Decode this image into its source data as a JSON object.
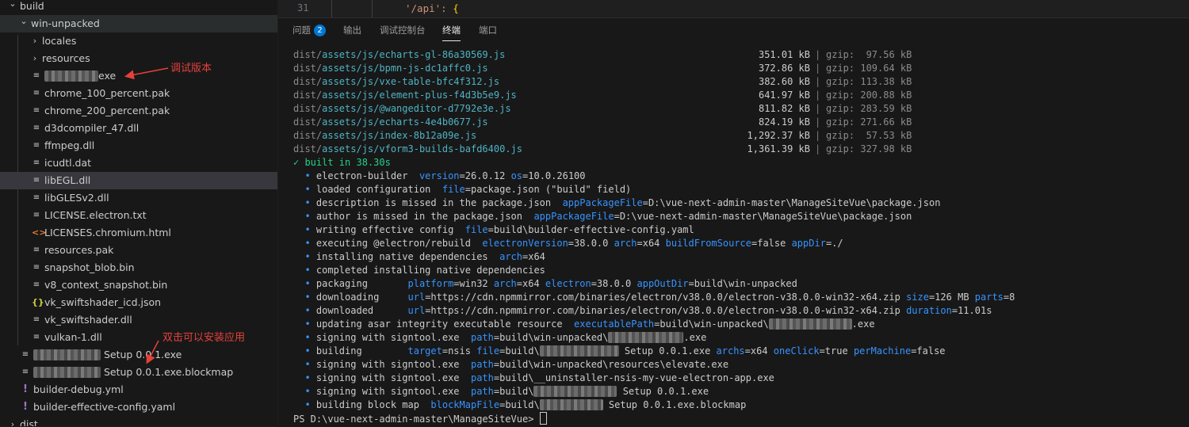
{
  "explorer": {
    "items": [
      {
        "type": "folder",
        "open": true,
        "indent": 0,
        "label": "build",
        "cls": ""
      },
      {
        "type": "folder",
        "open": true,
        "indent": 1,
        "label": "win-unpacked",
        "cls": "sel-top"
      },
      {
        "type": "folder",
        "open": false,
        "indent": 2,
        "label": "locales",
        "cls": ""
      },
      {
        "type": "folder",
        "open": false,
        "indent": 2,
        "label": "resources",
        "cls": ""
      },
      {
        "type": "file",
        "icon": "file",
        "indent": 2,
        "blur": 68,
        "label": "exe",
        "cls": ""
      },
      {
        "type": "file",
        "icon": "file",
        "indent": 2,
        "label": "chrome_100_percent.pak",
        "cls": ""
      },
      {
        "type": "file",
        "icon": "file",
        "indent": 2,
        "label": "chrome_200_percent.pak",
        "cls": ""
      },
      {
        "type": "file",
        "icon": "file",
        "indent": 2,
        "label": "d3dcompiler_47.dll",
        "cls": ""
      },
      {
        "type": "file",
        "icon": "file",
        "indent": 2,
        "label": "ffmpeg.dll",
        "cls": ""
      },
      {
        "type": "file",
        "icon": "file",
        "indent": 2,
        "label": "icudtl.dat",
        "cls": ""
      },
      {
        "type": "file",
        "icon": "file",
        "indent": 2,
        "label": "libEGL.dll",
        "cls": "sel"
      },
      {
        "type": "file",
        "icon": "file",
        "indent": 2,
        "label": "libGLESv2.dll",
        "cls": ""
      },
      {
        "type": "file",
        "icon": "file",
        "indent": 2,
        "label": "LICENSE.electron.txt",
        "cls": ""
      },
      {
        "type": "file",
        "icon": "html",
        "indent": 2,
        "label": "LICENSES.chromium.html",
        "cls": ""
      },
      {
        "type": "file",
        "icon": "file",
        "indent": 2,
        "label": "resources.pak",
        "cls": ""
      },
      {
        "type": "file",
        "icon": "file",
        "indent": 2,
        "label": "snapshot_blob.bin",
        "cls": ""
      },
      {
        "type": "file",
        "icon": "file",
        "indent": 2,
        "label": "v8_context_snapshot.bin",
        "cls": ""
      },
      {
        "type": "file",
        "icon": "json",
        "indent": 2,
        "label": "vk_swiftshader_icd.json",
        "cls": ""
      },
      {
        "type": "file",
        "icon": "file",
        "indent": 2,
        "label": "vk_swiftshader.dll",
        "cls": ""
      },
      {
        "type": "file",
        "icon": "file",
        "indent": 2,
        "label": "vulkan-1.dll",
        "cls": ""
      },
      {
        "type": "file",
        "icon": "file",
        "indent": 1,
        "blur": 85,
        "label": "Setup 0.0.1.exe",
        "cls": ""
      },
      {
        "type": "file",
        "icon": "file",
        "indent": 1,
        "blur": 85,
        "label": "Setup 0.0.1.exe.blockmap",
        "cls": ""
      },
      {
        "type": "file",
        "icon": "yml",
        "indent": 1,
        "label": "builder-debug.yml",
        "cls": ""
      },
      {
        "type": "file",
        "icon": "yml",
        "indent": 1,
        "label": "builder-effective-config.yaml",
        "cls": ""
      },
      {
        "type": "folder",
        "open": false,
        "indent": 0,
        "label": "dist",
        "cls": ""
      }
    ]
  },
  "annotations": {
    "debug_version": "调试版本",
    "double_click_install": "双击可以安装应用"
  },
  "editor": {
    "line_number": "31",
    "code": "'/api': {"
  },
  "panel": {
    "tabs": [
      {
        "label": "问题",
        "badge": "2"
      },
      {
        "label": "输出"
      },
      {
        "label": "调试控制台"
      },
      {
        "label": "终端",
        "active": true
      },
      {
        "label": "端口"
      }
    ]
  },
  "terminal": {
    "assets": [
      {
        "prefix": "dist/",
        "path": "assets/js/echarts-gl-86a30569.js",
        "size": "351.01 kB",
        "gzip": "gzip:  97.56 kB"
      },
      {
        "prefix": "dist/",
        "path": "assets/js/bpmn-js-dc1affc0.js",
        "size": "372.86 kB",
        "gzip": "gzip: 109.64 kB"
      },
      {
        "prefix": "dist/",
        "path": "assets/js/vxe-table-bfc4f312.js",
        "size": "382.60 kB",
        "gzip": "gzip: 113.38 kB"
      },
      {
        "prefix": "dist/",
        "path": "assets/js/element-plus-f4d3b5e9.js",
        "size": "641.97 kB",
        "gzip": "gzip: 200.88 kB"
      },
      {
        "prefix": "dist/",
        "path": "assets/js/@wangeditor-d7792e3e.js",
        "size": "811.82 kB",
        "gzip": "gzip: 283.59 kB"
      },
      {
        "prefix": "dist/",
        "path": "assets/js/echarts-4e4b0677.js",
        "size": "824.19 kB",
        "gzip": "gzip: 271.66 kB"
      },
      {
        "prefix": "dist/",
        "path": "assets/js/index-8b12a09e.js",
        "size": "1,292.37 kB",
        "gzip": "gzip:  57.53 kB"
      },
      {
        "prefix": "dist/",
        "path": "assets/js/vform3-builds-bafd6400.js",
        "size": "1,361.39 kB",
        "gzip": "gzip: 327.98 kB"
      }
    ],
    "built": "✓ built in 38.30s",
    "log": [
      [
        [
          "t",
          "electron-builder  "
        ],
        [
          "k",
          "version"
        ],
        [
          "t",
          "=26.0.12 "
        ],
        [
          "k",
          "os"
        ],
        [
          "t",
          "=10.0.26100"
        ]
      ],
      [
        [
          "t",
          "loaded configuration  "
        ],
        [
          "k",
          "file"
        ],
        [
          "t",
          "=package.json (\"build\" field)"
        ]
      ],
      [
        [
          "t",
          "description is missed in the package.json  "
        ],
        [
          "k",
          "appPackageFile"
        ],
        [
          "t",
          "=D:\\vue-next-admin-master\\ManageSiteVue\\package.json"
        ]
      ],
      [
        [
          "t",
          "author is missed in the package.json  "
        ],
        [
          "k",
          "appPackageFile"
        ],
        [
          "t",
          "=D:\\vue-next-admin-master\\ManageSiteVue\\package.json"
        ]
      ],
      [
        [
          "t",
          "writing effective config  "
        ],
        [
          "k",
          "file"
        ],
        [
          "t",
          "=build\\builder-effective-config.yaml"
        ]
      ],
      [
        [
          "t",
          "executing @electron/rebuild  "
        ],
        [
          "k",
          "electronVersion"
        ],
        [
          "t",
          "=38.0.0 "
        ],
        [
          "k",
          "arch"
        ],
        [
          "t",
          "=x64 "
        ],
        [
          "k",
          "buildFromSource"
        ],
        [
          "t",
          "=false "
        ],
        [
          "k",
          "appDir"
        ],
        [
          "t",
          "=./"
        ]
      ],
      [
        [
          "t",
          "installing native dependencies  "
        ],
        [
          "k",
          "arch"
        ],
        [
          "t",
          "=x64"
        ]
      ],
      [
        [
          "t",
          "completed installing native dependencies"
        ]
      ],
      [
        [
          "t",
          "packaging       "
        ],
        [
          "k",
          "platform"
        ],
        [
          "t",
          "=win32 "
        ],
        [
          "k",
          "arch"
        ],
        [
          "t",
          "=x64 "
        ],
        [
          "k",
          "electron"
        ],
        [
          "t",
          "=38.0.0 "
        ],
        [
          "k",
          "appOutDir"
        ],
        [
          "t",
          "=build\\win-unpacked"
        ]
      ],
      [
        [
          "t",
          "downloading     "
        ],
        [
          "k",
          "url"
        ],
        [
          "t",
          "=https://cdn.npmmirror.com/binaries/electron/v38.0.0/electron-v38.0.0-win32-x64.zip "
        ],
        [
          "k",
          "size"
        ],
        [
          "t",
          "=126 MB "
        ],
        [
          "k",
          "parts"
        ],
        [
          "t",
          "=8"
        ]
      ],
      [
        [
          "t",
          "downloaded      "
        ],
        [
          "k",
          "url"
        ],
        [
          "t",
          "=https://cdn.npmmirror.com/binaries/electron/v38.0.0/electron-v38.0.0-win32-x64.zip "
        ],
        [
          "k",
          "duration"
        ],
        [
          "t",
          "=11.01s"
        ]
      ],
      [
        [
          "t",
          "updating asar integrity executable resource  "
        ],
        [
          "k",
          "executablePath"
        ],
        [
          "t",
          "=build\\win-unpacked\\"
        ],
        [
          "b",
          105
        ],
        [
          "t",
          ".exe"
        ]
      ],
      [
        [
          "t",
          "signing with signtool.exe  "
        ],
        [
          "k",
          "path"
        ],
        [
          "t",
          "=build\\win-unpacked\\"
        ],
        [
          "b",
          95
        ],
        [
          "t",
          ".exe"
        ]
      ],
      [
        [
          "t",
          "building        "
        ],
        [
          "k",
          "target"
        ],
        [
          "t",
          "=nsis "
        ],
        [
          "k",
          "file"
        ],
        [
          "t",
          "=build\\"
        ],
        [
          "b",
          100
        ],
        [
          "t",
          " Setup 0.0.1.exe "
        ],
        [
          "k",
          "archs"
        ],
        [
          "t",
          "=x64 "
        ],
        [
          "k",
          "oneClick"
        ],
        [
          "t",
          "=true "
        ],
        [
          "k",
          "perMachine"
        ],
        [
          "t",
          "=false"
        ]
      ],
      [
        [
          "t",
          "signing with signtool.exe  "
        ],
        [
          "k",
          "path"
        ],
        [
          "t",
          "=build\\win-unpacked\\resources\\elevate.exe"
        ]
      ],
      [
        [
          "t",
          "signing with signtool.exe  "
        ],
        [
          "k",
          "path"
        ],
        [
          "t",
          "=build\\__uninstaller-nsis-my-vue-electron-app.exe"
        ]
      ],
      [
        [
          "t",
          "signing with signtool.exe  "
        ],
        [
          "k",
          "path"
        ],
        [
          "t",
          "=build\\"
        ],
        [
          "b",
          105
        ],
        [
          "t",
          " Setup 0.0.1.exe"
        ]
      ],
      [
        [
          "t",
          "building block map  "
        ],
        [
          "k",
          "blockMapFile"
        ],
        [
          "t",
          "=build\\"
        ],
        [
          "b",
          80
        ],
        [
          "t",
          " Setup 0.0.1.exe.blockmap"
        ]
      ]
    ],
    "prompt": "PS D:\\vue-next-admin-master\\ManageSiteVue> "
  }
}
